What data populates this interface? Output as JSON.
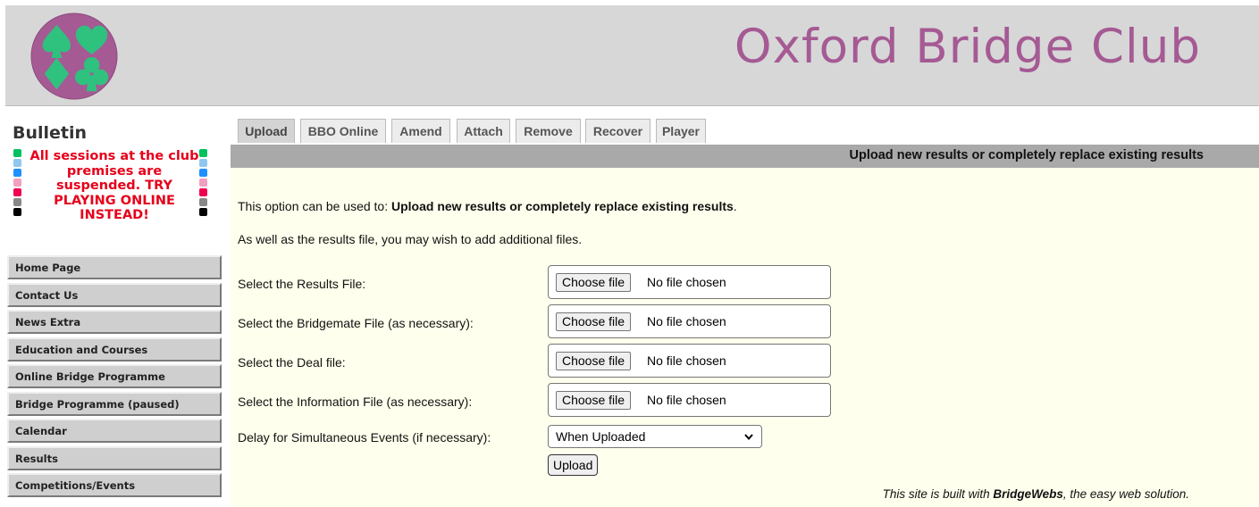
{
  "header": {
    "site_title": "Oxford Bridge Club"
  },
  "sidebar": {
    "bulletin_title": "Bulletin",
    "bulletin_message": "All sessions at the club premises are suspended. TRY PLAYING ONLINE INSTEAD!",
    "menu_items": [
      {
        "label": "Home Page"
      },
      {
        "label": "Contact Us"
      },
      {
        "label": "News Extra"
      },
      {
        "label": "Education and Courses"
      },
      {
        "label": "Online Bridge Programme"
      },
      {
        "label": "Bridge Programme (paused)"
      },
      {
        "label": "Calendar"
      },
      {
        "label": "Results"
      },
      {
        "label": "Competitions/Events"
      }
    ]
  },
  "tabs": [
    {
      "label": "Upload",
      "active": true
    },
    {
      "label": "BBO Online"
    },
    {
      "label": "Amend"
    },
    {
      "label": "Attach"
    },
    {
      "label": "Remove"
    },
    {
      "label": "Recover"
    },
    {
      "label": "Player"
    }
  ],
  "banner": {
    "title": "Upload new results or completely replace existing results"
  },
  "content": {
    "intro_prefix": "This option can be used to: ",
    "intro_bold": "Upload new results or completely replace existing results",
    "intro_suffix": ".",
    "additional": "As well as the results file, you may wish to add additional files.",
    "file_fields": [
      {
        "label": "Select the Results File:",
        "button": "Choose file",
        "status": "No file chosen"
      },
      {
        "label": "Select the Bridgemate File (as necessary):",
        "button": "Choose file",
        "status": "No file chosen"
      },
      {
        "label": "Select the Deal file:",
        "button": "Choose file",
        "status": "No file chosen"
      },
      {
        "label": "Select the Information File (as necessary):",
        "button": "Choose file",
        "status": "No file chosen"
      }
    ],
    "delay": {
      "label": "Delay for Simultaneous Events (if necessary):",
      "value": "When Uploaded"
    },
    "upload_button": "Upload"
  },
  "footer": {
    "prefix": "This site is built with ",
    "brand": "BridgeWebs",
    "suffix": ", the easy web solution."
  },
  "colors": {
    "title": "#a55a94",
    "logo_circle": "#a55a94",
    "logo_suits": "#2ec27e",
    "bulletin": "#e6001a",
    "content_bg": "#ffffed"
  }
}
